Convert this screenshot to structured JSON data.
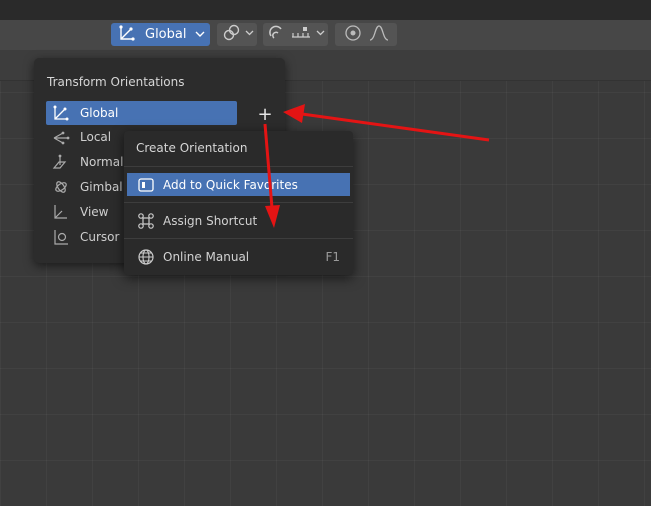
{
  "header": {
    "orientation_button": {
      "label": "Global",
      "icon": "transform-axes-icon"
    },
    "snap_icons": [
      "link-icon",
      "chevron-down-icon"
    ],
    "snap_increment_icons": [
      "magnet-icon",
      "snap-increment-icon",
      "chevron-down-icon"
    ],
    "proportional_icons": [
      "proportional-edit-icon",
      "falloff-curve-icon"
    ]
  },
  "orientations_panel": {
    "title": "Transform Orientations",
    "add_label": "+",
    "items": [
      {
        "label": "Global",
        "icon": "global-axes-icon",
        "selected": true
      },
      {
        "label": "Local",
        "icon": "local-axes-icon",
        "selected": false
      },
      {
        "label": "Normal",
        "icon": "normal-icon",
        "selected": false
      },
      {
        "label": "Gimbal",
        "icon": "gimbal-icon",
        "selected": false
      },
      {
        "label": "View",
        "icon": "view-icon",
        "selected": false
      },
      {
        "label": "Cursor",
        "icon": "cursor-icon",
        "selected": false
      }
    ]
  },
  "context_menu": {
    "title": "Create Orientation",
    "items": [
      {
        "label": "Add to Quick Favorites",
        "icon": "quick-favorites-icon",
        "shortcut": "",
        "highlighted": true
      },
      {
        "label": "Assign Shortcut",
        "icon": "command-key-icon",
        "shortcut": "",
        "highlighted": false
      },
      {
        "label": "Online Manual",
        "icon": "globe-icon",
        "shortcut": "F1",
        "highlighted": false
      }
    ]
  },
  "colors": {
    "accent": "#4772b3",
    "annotation_arrow": "#e41414",
    "panel_bg": "#2c2c2c",
    "viewport_bg": "#3a3a3a"
  }
}
